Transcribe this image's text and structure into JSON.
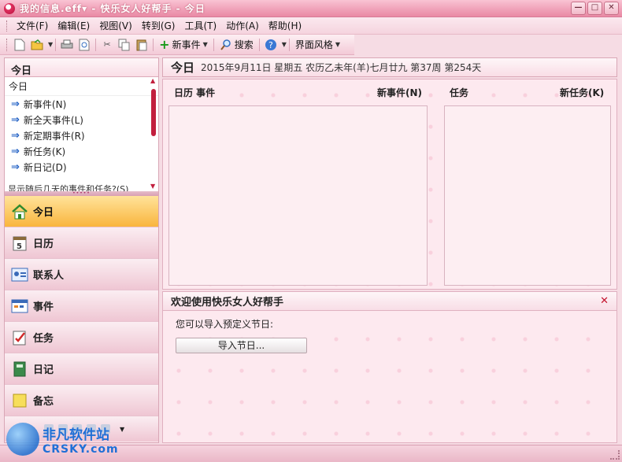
{
  "window": {
    "title": "我的信息.eff▾ - 快乐女人好帮手 - 今日",
    "btn_min": "—",
    "btn_max": "□",
    "btn_close": "✕"
  },
  "menu": [
    "文件(F)",
    "编辑(E)",
    "视图(V)",
    "转到(G)",
    "工具(T)",
    "动作(A)",
    "帮助(H)"
  ],
  "toolbar": {
    "new_event": "新事件",
    "search": "搜索",
    "skin": "界面风格"
  },
  "left": {
    "header": "今日",
    "task_title": "今日",
    "tasks": [
      "新事件(N)",
      "新全天事件(L)",
      "新定期事件(R)",
      "新任务(K)",
      "新日记(D)"
    ],
    "more": "显示随后几天的事件和任务?(S)",
    "nav": [
      {
        "label": "今日",
        "icon": "home-icon"
      },
      {
        "label": "日历",
        "icon": "calendar-icon"
      },
      {
        "label": "联系人",
        "icon": "contact-card-icon"
      },
      {
        "label": "事件",
        "icon": "event-icon"
      },
      {
        "label": "任务",
        "icon": "task-check-icon"
      },
      {
        "label": "日记",
        "icon": "diary-icon"
      },
      {
        "label": "备忘",
        "icon": "memo-icon"
      }
    ]
  },
  "main": {
    "title": "今日",
    "date_line": "2015年9月11日 星期五 农历乙未年(羊)七月廿九 第37周 第254天",
    "calendar_head": "日历 事件",
    "new_event": "新事件(N)",
    "task_head": "任务",
    "new_task": "新任务(K)"
  },
  "welcome": {
    "title": "欢迎使用快乐女人好帮手",
    "text": "您可以导入预定义节日:",
    "button": "导入节日..."
  },
  "watermark": {
    "cn": "非凡软件站",
    "en": "CRSKY.com"
  }
}
